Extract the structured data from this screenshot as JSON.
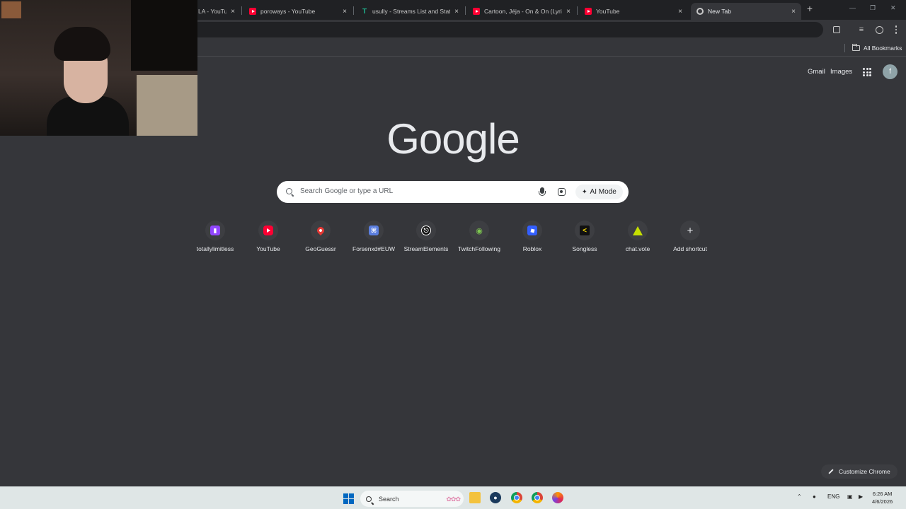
{
  "tabs": [
    {
      "title": "LA - YouTu",
      "favicon": "youtube-icon",
      "active": false
    },
    {
      "title": "poroways - YouTube",
      "favicon": "youtube-icon",
      "active": false
    },
    {
      "title": "usully - Streams List and Statistics",
      "favicon": "tt-icon",
      "active": false
    },
    {
      "title": "Cartoon, Jéja - On & On (Lyrics)",
      "favicon": "youtube-icon",
      "active": false
    },
    {
      "title": "YouTube",
      "favicon": "youtube-icon",
      "active": false
    },
    {
      "title": "New Tab",
      "favicon": "chrome-icon",
      "active": true
    }
  ],
  "tab_close_glyph": "×",
  "new_tab_glyph": "+",
  "bookmarks": {
    "all_bookmarks_label": "All Bookmarks"
  },
  "top_links": {
    "gmail": "Gmail",
    "images": "Images",
    "avatar_letter": "f"
  },
  "logo_text": "Google",
  "search": {
    "placeholder": "Search Google or type a URL",
    "ai_mode_label": "AI Mode"
  },
  "shortcuts": [
    {
      "label": "totallylimitless",
      "icon": "twitch-icon"
    },
    {
      "label": "YouTube",
      "icon": "youtube-icon"
    },
    {
      "label": "GeoGuessr",
      "icon": "map-pin-icon"
    },
    {
      "label": "Forsenxd#EUW",
      "icon": "command-icon"
    },
    {
      "label": "StreamElements",
      "icon": "streamelements-icon"
    },
    {
      "label": "TwitchFollowing",
      "icon": "frog-icon"
    },
    {
      "label": "Roblox",
      "icon": "roblox-icon"
    },
    {
      "label": "Songless",
      "icon": "songless-icon"
    },
    {
      "label": "chat.vote",
      "icon": "triangle-icon"
    },
    {
      "label": "Add shortcut",
      "icon": "plus-icon"
    }
  ],
  "customize_label": "Customize Chrome",
  "taskbar": {
    "search_label": "Search",
    "language": "ENG",
    "time": "6:26 AM",
    "date": "4/6/2026"
  },
  "colors": {
    "page_bg": "#35363a",
    "tabstrip_bg": "#202124",
    "taskbar_bg": "#dfe6e6",
    "accent_blue": "#0067c0"
  }
}
